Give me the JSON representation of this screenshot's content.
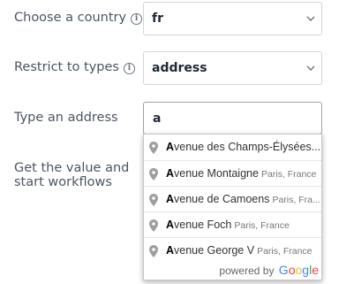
{
  "country": {
    "label": "Choose a country",
    "value": "fr"
  },
  "types": {
    "label": "Restrict to types",
    "value": "address"
  },
  "address": {
    "label": "Type an address",
    "value": "a"
  },
  "workflow": {
    "label_line1": "Get the value and",
    "label_line2": "start workflows"
  },
  "suggestions": [
    {
      "match": "A",
      "rest": "venue des Champs-Élysées...",
      "secondary": ""
    },
    {
      "match": "A",
      "rest": "venue Montaigne",
      "secondary": "Paris, France"
    },
    {
      "match": "A",
      "rest": "venue de Camoens",
      "secondary": "Paris, Fra..."
    },
    {
      "match": "A",
      "rest": "venue Foch",
      "secondary": "Paris, France"
    },
    {
      "match": "A",
      "rest": "venue George V",
      "secondary": "Paris, France"
    }
  ],
  "attribution": {
    "text": "powered by",
    "logo_letters": [
      "G",
      "o",
      "o",
      "g",
      "l",
      "e"
    ],
    "logo_colors": [
      "#4285F4",
      "#EA4335",
      "#FBBC05",
      "#4285F4",
      "#34A853",
      "#EA4335"
    ]
  },
  "colors": {
    "label": "#4b5563",
    "border": "#d1d5db",
    "pin": "#9e9e9e"
  }
}
